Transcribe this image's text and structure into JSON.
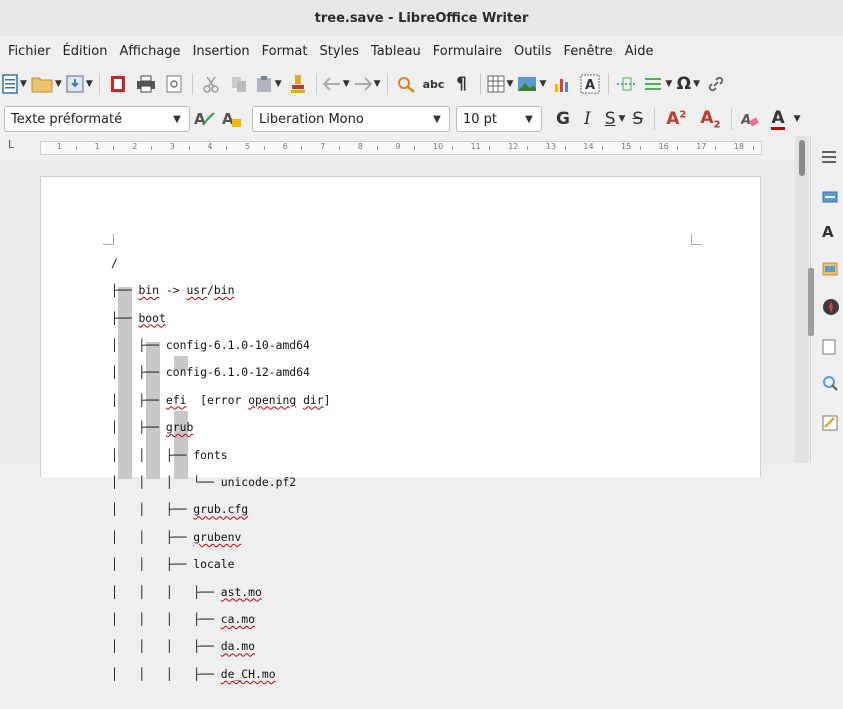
{
  "window": {
    "title": "tree.save - LibreOffice Writer"
  },
  "menu": [
    "Fichier",
    "Édition",
    "Affichage",
    "Insertion",
    "Format",
    "Styles",
    "Tableau",
    "Formulaire",
    "Outils",
    "Fenêtre",
    "Aide"
  ],
  "toolbar2": {
    "paragraph_style": "Texte préformaté",
    "font_name": "Liberation Mono",
    "font_size": "10 pt",
    "bold": "G",
    "italic": "I",
    "underline": "S",
    "strike": "S",
    "superscript": "A",
    "superscript_mark": "2",
    "subscript": "A",
    "subscript_mark": "2",
    "font_color": "A"
  },
  "toolbar1": {
    "pilcrow": "¶",
    "abc": "abc",
    "omega": "Ω"
  },
  "ruler": {
    "numbers": [
      "1",
      "1",
      "2",
      "3",
      "4",
      "5",
      "6",
      "7",
      "8",
      "9",
      "10",
      "11",
      "12",
      "13",
      "14",
      "15",
      "16",
      "17",
      "18"
    ]
  },
  "document": {
    "lines": [
      "/",
      "├── bin -> usr/bin",
      "├── boot",
      "│   ├── config-6.1.0-10-amd64",
      "│   ├── config-6.1.0-12-amd64",
      "│   ├── efi  [error opening dir]",
      "│   ├── grub",
      "│   │   ├── fonts",
      "│   │   │   └── unicode.pf2",
      "│   │   ├── grub.cfg",
      "│   │   ├── grubenv",
      "│   │   ├── locale",
      "│   │   │   ├── ast.mo",
      "│   │   │   ├── ca.mo",
      "│   │   │   ├── da.mo",
      "│   │   │   ├── de_CH.mo"
    ]
  },
  "sidebar": {
    "icons": [
      "properties-icon",
      "styles-icon",
      "gallery-icon",
      "navigator-icon",
      "page-icon",
      "style-inspector-icon",
      "manage-changes-icon"
    ]
  },
  "colors": {
    "accent_red": "#c00000",
    "spell_squiggle": "#cc0000"
  }
}
